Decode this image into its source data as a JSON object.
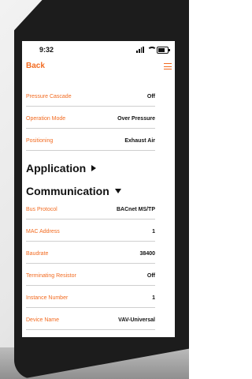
{
  "status_bar": {
    "time": "9:32"
  },
  "navbar": {
    "back_label": "Back"
  },
  "settings_rows_top": [
    {
      "label": "Pressure Cascade",
      "value": "Off"
    },
    {
      "label": "Operation Mode",
      "value": "Over Pressure"
    },
    {
      "label": "Positioning",
      "value": "Exhaust Air"
    }
  ],
  "sections": {
    "application": {
      "title": "Application"
    },
    "communication": {
      "title": "Communication"
    }
  },
  "communication_rows": [
    {
      "label": "Bus Protocol",
      "value": "BACnet MS/TP"
    },
    {
      "label": "MAC Address",
      "value": "1"
    },
    {
      "label": "Baudrate",
      "value": "38400"
    },
    {
      "label": "Terminating Resistor",
      "value": "Off"
    },
    {
      "label": "Instance Number",
      "value": "1"
    },
    {
      "label": "Device Name",
      "value": "VAV-Universal"
    }
  ],
  "colors": {
    "accent": "#f26b21",
    "text": "#111111",
    "divider": "#cfcfcf",
    "phone_body": "#1c1c1c"
  },
  "icons": [
    "signal-icon",
    "wifi-icon",
    "battery-icon",
    "hamburger-menu-icon",
    "chevron-right-icon",
    "chevron-down-icon"
  ]
}
